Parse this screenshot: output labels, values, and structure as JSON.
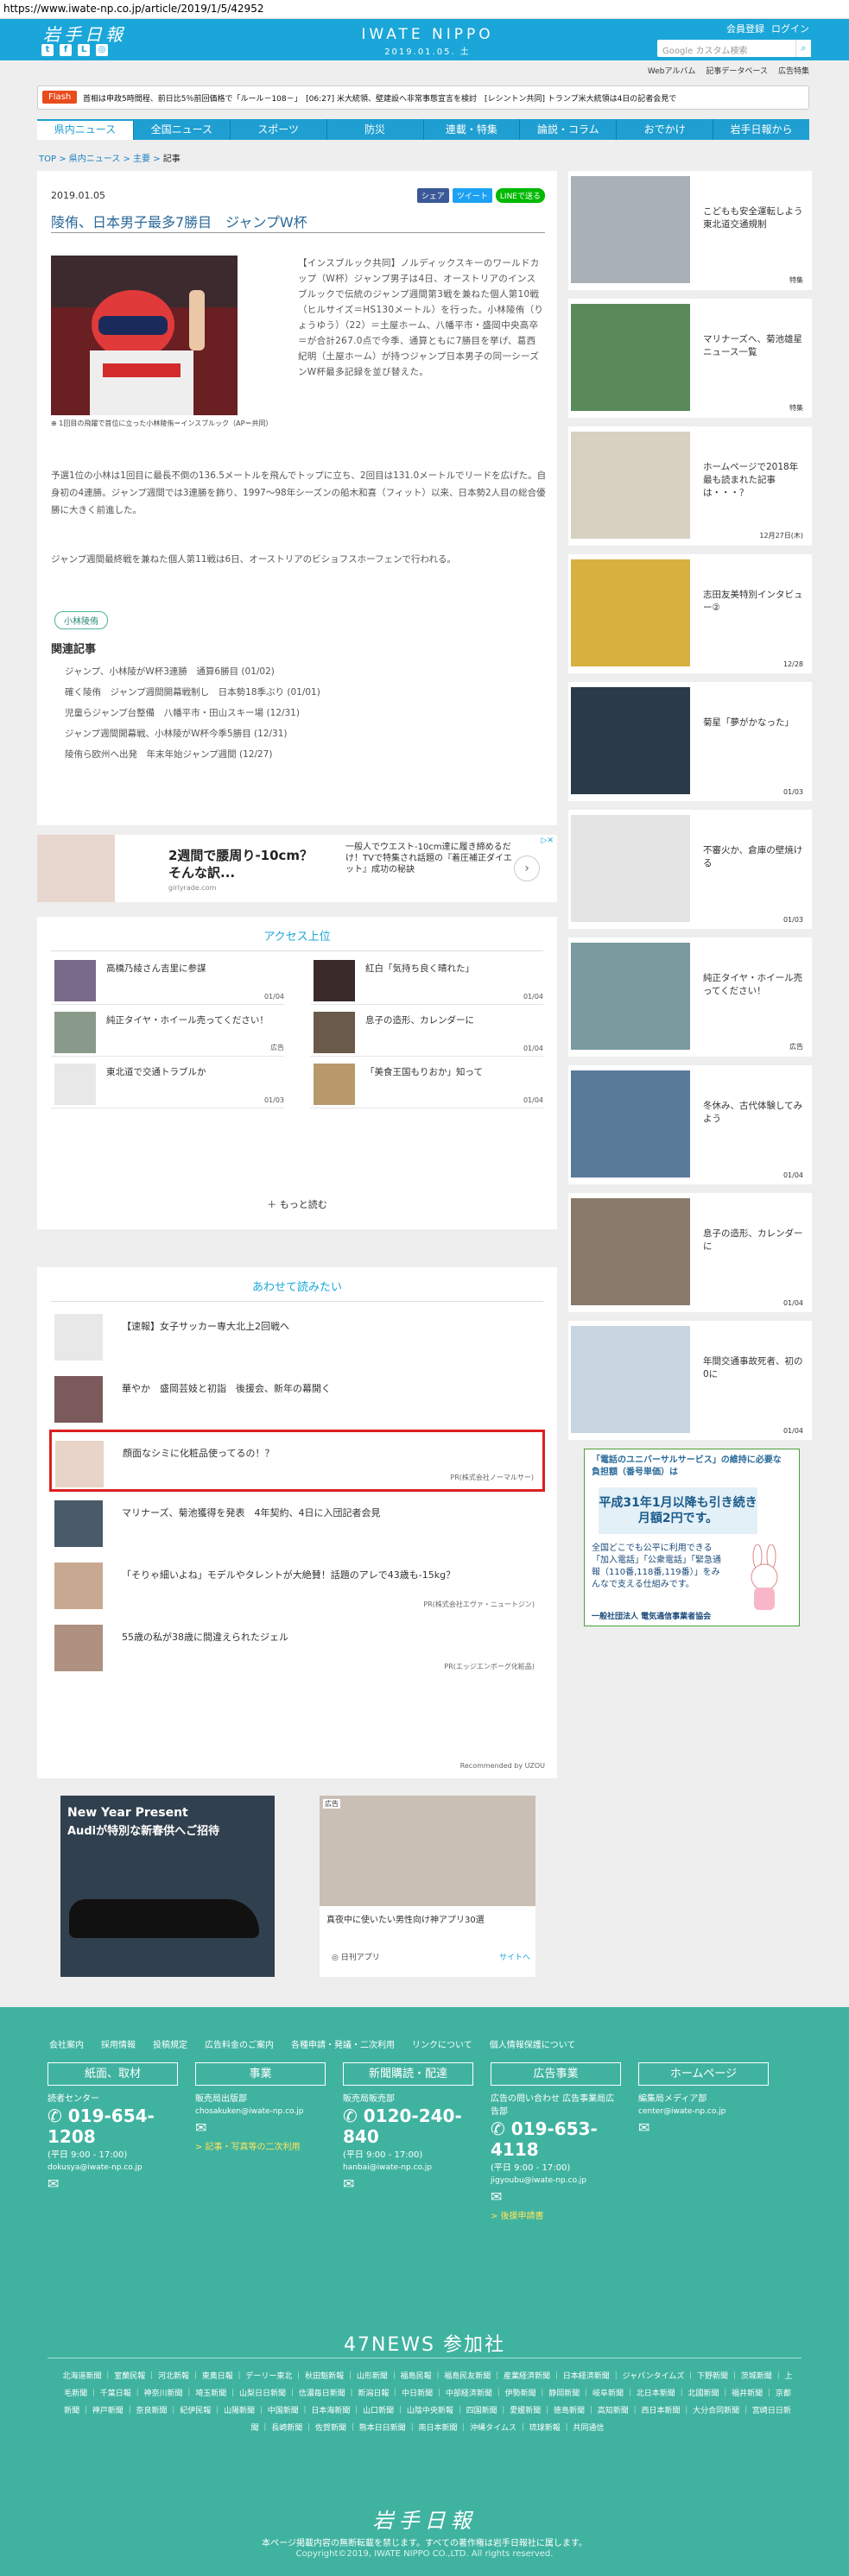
{
  "url": "https://www.iwate-np.co.jp/article/2019/1/5/42952",
  "header": {
    "logo_jp": "岩手日報",
    "brand_en": "IWATE NIPPO",
    "date": "2019.01.05. 土",
    "member_register": "会員登録",
    "login": "ログイン",
    "search_placeholder": "Google カスタム検索",
    "social": [
      "twitter-icon",
      "facebook-icon",
      "line-icon",
      "instagram-icon"
    ]
  },
  "sub_links": [
    "Webアルバム",
    "記事データベース",
    "広告特集"
  ],
  "flash": {
    "tag": "Flash",
    "text": "首相は申政5時間程、前日比5％前回価格で「ルール－108－」　[06:27] 米大統領、壁建設へ非常事態宣言を検討　[レシントン共同] トランプ米大統領は4日の記者会見で"
  },
  "nav": [
    "県内ニュース",
    "全国ニュース",
    "スポーツ",
    "防災",
    "連載・特集",
    "論説・コラム",
    "おでかけ",
    "岩手日報から"
  ],
  "breadcrumb": [
    "TOP",
    "県内ニュース",
    "主要",
    "記事"
  ],
  "article": {
    "date": "2019.01.05",
    "share": [
      "シェア",
      "ツイート",
      "LINEで送る"
    ],
    "title": "陵侑、日本男子最多7勝目　ジャンプW杯",
    "caption": "1回目の飛躍で首位に立った小林陵侑＝インスブルック（AP＝共同）",
    "lead": "【インスブルック共同】ノルディックスキーのワールドカップ（W杯）ジャンプ男子は4日、オーストリアのインスブルックで伝統のジャンプ週間第3戦を兼ねた個人第10戦（ヒルサイズ＝HS130メートル）を行った。小林陵侑（りょうゆう）（22）＝土屋ホーム、八幡平市・盛岡中央高卒＝が合計267.0点で今季、通算ともに7勝目を挙げ、葛西紀明（土屋ホーム）が持つジャンプ日本男子の同一シーズンW杯最多記録を並び替えた。",
    "p2": "予選1位の小林は1回目に最長不倒の136.5メートルを飛んでトップに立ち、2回目は131.0メートルでリードを広げた。自身初の4連勝。ジャンプ週間では3連勝を飾り、1997～98年シーズンの船木和喜（フィット）以来、日本勢2人目の総合優勝に大きく前進した。",
    "p3": "ジャンプ週間最終戦を兼ねた個人第11戦は6日、オーストリアのビショフスホーフェンで行われる。",
    "tag": "小林陵侑",
    "related_head": "関連記事",
    "related": [
      "ジャンプ、小林陵がW杯3連勝　通算6勝目 (01/02)",
      "確く陵侑　ジャンプ週間開幕戦制し　日本勢18季ぶり (01/01)",
      "児童らジャンプ台整備　八幡平市・田山スキー場 (12/31)",
      "ジャンプ週間開幕戦、小林陵がW杯今季5勝目 (12/31)",
      "陵侑ら欧州へ出発　年末年始ジャンプ週間 (12/27)"
    ]
  },
  "ad1": {
    "t1": "2週間で腰周り-10cm？",
    "t2": "そんな訳...",
    "src": "girlyrade.com",
    "right_text": "一般人でウエスト-10cm達に履き締めるだけ！TVで特集され話題の『着圧補正ダイエット』成功の秘訣"
  },
  "ranking": {
    "title": "アクセス上位",
    "items": [
      {
        "title": "高橋乃綾さん吉里に参謀",
        "date": "01/04"
      },
      {
        "title": "紅白「気持ち良く晴れた」",
        "date": "01/04"
      },
      {
        "title": "純正タイヤ・ホイール売ってください！",
        "date": "広告"
      },
      {
        "title": "息子の造形、カレンダーに",
        "date": "01/04"
      },
      {
        "title": "東北道で交通トラブルか",
        "date": "01/03"
      },
      {
        "title": "「美食王国もりおか」知って",
        "date": "01/04"
      }
    ],
    "more": "もっと読む"
  },
  "reco": {
    "title": "あわせて読みたい",
    "items": [
      {
        "title": "【速報】女子サッカー専大北上2回戦へ",
        "pr": ""
      },
      {
        "title": "華やか　盛岡芸妓と初詣　後援会、新年の幕開く",
        "pr": ""
      },
      {
        "title": "顔面なシミに化粧品使ってるの！？",
        "pr": "PR(株式会社ノーマルサー)"
      },
      {
        "title": "マリナーズ、菊池獲得を発表　4年契約、4日に入団記者会見",
        "pr": ""
      },
      {
        "title": "「そりゃ細いよね」モデルやタレントが大絶賛！話題のアレで43歳も-15kg？",
        "pr": "PR(株式会社エヴァ・ニュートジン)"
      },
      {
        "title": "55歳の私が38歳に間違えられたジェル",
        "pr": "PR(エッジエンボーグ化粧品)"
      }
    ],
    "footer": "Recommended by UZOU"
  },
  "ad2": {
    "t1": "New Year Present",
    "t2": "Audiが特別な新春供へご招待"
  },
  "ad3": {
    "label": "広告",
    "caption": "真夜中に使いたい男性向け神アプリ30選",
    "source": "日刊アプリ",
    "site": "サイトへ"
  },
  "sidebar": [
    {
      "title": "こどもも安全運転しよう　東北道交通規制",
      "date": "特集"
    },
    {
      "title": "マリナーズへ、菊池雄星ニュース一覧",
      "date": "特集"
    },
    {
      "title": "ホームページで2018年最も読まれた記事は・・・？",
      "date": "12月27日(木)"
    },
    {
      "title": "志田友美特別インタビュー②",
      "date": "12/28"
    },
    {
      "title": "菊星「夢がかなった」",
      "date": "01/03"
    },
    {
      "title": "不審火か、倉庫の壁焼ける",
      "date": "01/03"
    },
    {
      "title": "純正タイヤ・ホイール売ってください！",
      "date": "広告"
    },
    {
      "title": "冬休み、古代体験してみよう",
      "date": "01/04"
    },
    {
      "title": "息子の造形、カレンダーに",
      "date": "01/04"
    },
    {
      "title": "年間交通事故死者、初の0に",
      "date": "01/04"
    }
  ],
  "side_banner": {
    "head": "「電話のユニバーサルサービス」の維持に必要な負担額（番号単価）は",
    "big": "平成31年1月以降も引き続き月額2円です。",
    "body": "全国どこでも公平に利用できる「加入電話」「公衆電話」「緊急通報（110番,118番,119番）」をみんなで支える仕組みです。",
    "org": "一般社団法人 電気通信事業者協会"
  },
  "footer": {
    "links": [
      "会社案内",
      "採用情報",
      "投稿規定",
      "広告料金のご案内",
      "各種申請・発議・二次利用",
      "リンクについて",
      "個人情報保護について"
    ],
    "cols": [
      {
        "btn": "紙面、取材",
        "lbl": "読者センター",
        "tel": "019-654-1208",
        "hours": "(平日 9:00 - 17:00)",
        "mail": "dokusya@iwate-np.co.jp",
        "extra": ""
      },
      {
        "btn": "事業",
        "lbl": "販売局出版部",
        "tel": "",
        "hours": "",
        "mail": "chosakuken@iwate-np.co.jp",
        "extra": "> 記事・写真等の二次利用"
      },
      {
        "btn": "新聞購読・配達",
        "lbl": "販売局販売部",
        "tel": "0120-240-840",
        "hours": "(平日 9:00 - 17:00)",
        "mail": "hanbai@iwate-np.co.jp",
        "extra": ""
      },
      {
        "btn": "広告事業",
        "lbl": "広告の問い合わせ 広告事業局広告部",
        "tel": "019-653-4118",
        "hours": "(平日 9:00 - 17:00)",
        "mail": "jigyoubu@iwate-np.co.jp",
        "extra": "> 後援申請書"
      },
      {
        "btn": "ホームページ",
        "lbl": "編集局メディア部",
        "tel": "",
        "hours": "",
        "mail": "center@iwate-np.co.jp",
        "extra": ""
      }
    ],
    "news47": "47NEWS 参加社",
    "papers": "北海道新聞 ｜ 室蘭民報 ｜ 河北新報 ｜ 東奥日報 ｜ デーリー東北 ｜ 秋田魁新報 ｜ 山形新聞 ｜ 福島民報 ｜ 福島民友新聞 ｜ 産業経済新聞 ｜ 日本経済新聞 ｜ ジャパンタイムズ ｜ 下野新聞 ｜ 茨城新聞 ｜ 上毛新聞 ｜ 千葉日報 ｜ 神奈川新聞 ｜ 埼玉新聞 ｜ 山梨日日新聞 ｜ 信濃毎日新聞 ｜ 新潟日報 ｜ 中日新聞 ｜ 中部経済新聞 ｜ 伊勢新聞 ｜ 静岡新聞 ｜ 岐阜新聞 ｜ 北日本新聞 ｜ 北國新聞 ｜ 福井新聞 ｜ 京都新聞 ｜ 神戸新聞 ｜ 奈良新聞 ｜ 紀伊民報 ｜ 山陽新聞 ｜ 中国新聞 ｜ 日本海新聞 ｜ 山口新聞 ｜ 山陰中央新報 ｜ 四国新聞 ｜ 愛媛新聞 ｜ 徳島新聞 ｜ 高知新聞 ｜ 西日本新聞 ｜ 大分合同新聞 ｜ 宮崎日日新聞 ｜ 長崎新聞 ｜ 佐賀新聞 ｜ 熊本日日新聞 ｜ 南日本新聞 ｜ 沖縄タイムス ｜ 琉球新報 ｜ 共同通信",
    "logo": "岩手日報",
    "note": "本ページ掲載内容の無断転載を禁じます。すべての著作権は岩手日報社に属します。",
    "copyright": "Copyright©2019, IWATE NIPPO CO.,LTD. All rights reserved."
  }
}
